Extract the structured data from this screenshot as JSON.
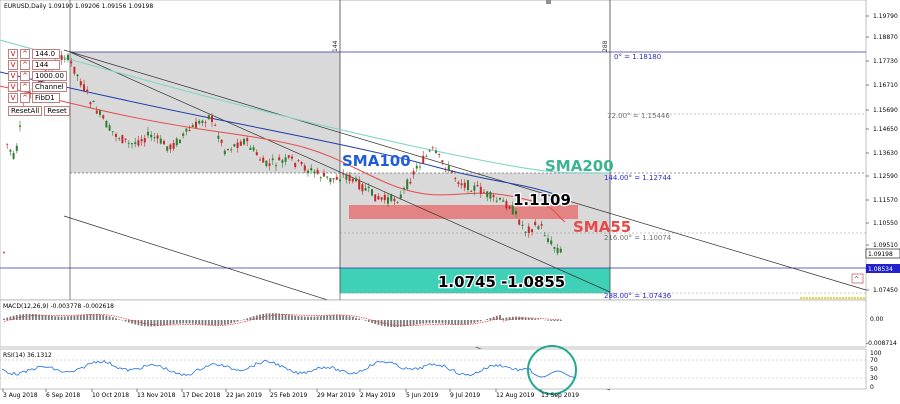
{
  "header": {
    "symbol_line": "EURUSD,Daily  1.09190 1.09206 1.09156 1.09198"
  },
  "controls": [
    {
      "value": "144.0"
    },
    {
      "value": "144"
    },
    {
      "value": "1000.00"
    },
    {
      "value": "Channel"
    },
    {
      "value": "FibD1"
    }
  ],
  "control_glyphs": {
    "v": "V",
    "caret": "^"
  },
  "buttons": {
    "reset_all": "ResetAll",
    "reset": "Reset"
  },
  "price_axis": {
    "labels": [
      "1.19790",
      "1.18870",
      "1.17730",
      "1.16710",
      "1.15690",
      "1.14650",
      "1.13630",
      "1.12590",
      "1.11570",
      "1.10550",
      "1.09510",
      "1.08534",
      "1.07450"
    ],
    "current_price": "1.09198",
    "marked_price": "1.08534"
  },
  "date_axis": [
    "3 Aug 2018",
    "6 Sep 2018",
    "10 Oct 2018",
    "13 Nov 2018",
    "17 Dec 2018",
    "22 Jan 2019",
    "25 Feb 2019",
    "29 Mar 2019",
    "2 May 2019",
    "5 Jun 2019",
    "9 Jul 2019",
    "12 Aug 2019",
    "13 Sep 2019"
  ],
  "vertical_labels": {
    "line1": "144",
    "line2": "288"
  },
  "fib_levels": [
    {
      "label": "0° = 1.18180"
    },
    {
      "label": "72.00° = 1.15446"
    },
    {
      "label": "144.00° = 1.12744"
    },
    {
      "label": "216.00° = 1.10074"
    },
    {
      "label": "288.00° = 1.07436"
    }
  ],
  "annotations": {
    "sma100": "SMA100",
    "sma200": "SMA200",
    "sma55": "SMA55",
    "level": "1.1109",
    "target": "1.0745 -1.0855"
  },
  "colors": {
    "sma100": "#1e5fd8",
    "sma200": "#3cb391",
    "sma55": "#e84a4a",
    "target_zone": "#3fd1b8",
    "resistance_zone": "#e57373",
    "candle_up": "#2e7d32",
    "candle_down": "#c62828"
  },
  "macd": {
    "label": "MACD(12,26,9) -0.003778 -0.002618",
    "ticks": [
      "0.00",
      "-0.008714"
    ]
  },
  "rsi": {
    "label": "RSI(14) 36.1312",
    "ticks": [
      "100",
      "70",
      "50",
      "30",
      "0"
    ]
  }
}
